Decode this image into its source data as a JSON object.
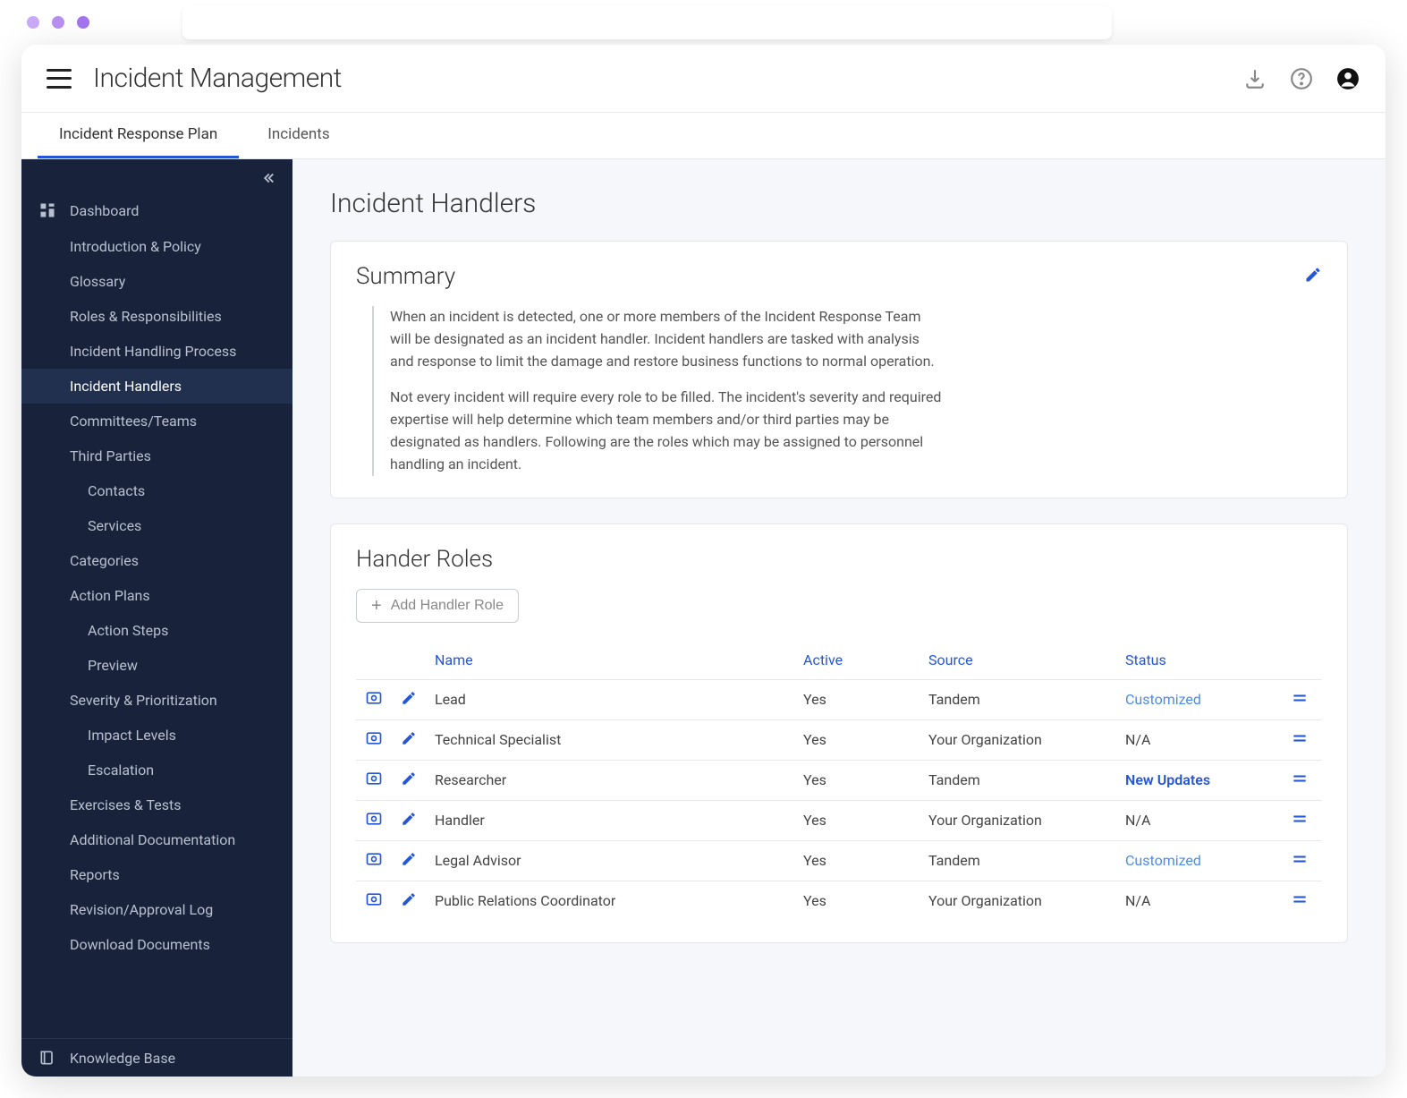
{
  "header": {
    "title": "Incident Management"
  },
  "tabs": [
    {
      "label": "Incident Response Plan",
      "active": true
    },
    {
      "label": "Incidents",
      "active": false
    }
  ],
  "sidebar": {
    "items": [
      {
        "label": "Dashboard",
        "icon": "dashboard"
      },
      {
        "label": "Introduction & Policy",
        "indent": 1
      },
      {
        "label": "Glossary",
        "indent": 1
      },
      {
        "label": "Roles & Responsibilities",
        "indent": 1
      },
      {
        "label": "Incident Handling Process",
        "indent": 1
      },
      {
        "label": "Incident Handlers",
        "indent": 1,
        "active": true
      },
      {
        "label": "Committees/Teams",
        "indent": 1
      },
      {
        "label": "Third Parties",
        "indent": 1
      },
      {
        "label": "Contacts",
        "indent": 2
      },
      {
        "label": "Services",
        "indent": 2
      },
      {
        "label": "Categories",
        "indent": 1
      },
      {
        "label": "Action Plans",
        "indent": 1
      },
      {
        "label": "Action Steps",
        "indent": 2
      },
      {
        "label": "Preview",
        "indent": 2
      },
      {
        "label": "Severity & Prioritization",
        "indent": 1
      },
      {
        "label": "Impact Levels",
        "indent": 2
      },
      {
        "label": "Escalation",
        "indent": 2
      },
      {
        "label": "Exercises & Tests",
        "indent": 1
      },
      {
        "label": "Additional Documentation",
        "indent": 1
      },
      {
        "label": "Reports",
        "indent": 1
      },
      {
        "label": "Revision/Approval Log",
        "indent": 1
      },
      {
        "label": "Download Documents",
        "indent": 1
      }
    ],
    "bottom": {
      "label": "Knowledge Base",
      "icon": "book"
    }
  },
  "page": {
    "title": "Incident Handlers",
    "summary": {
      "title": "Summary",
      "p1": "When an incident is detected, one or more members of the Incident Response Team will be designated as an incident handler. Incident handlers are tasked with analysis and response to limit the damage and restore business functions to normal operation.",
      "p2": "Not every incident will require every role to be filled. The incident's severity and required expertise will help determine which team members and/or third parties may be designated as handlers. Following are the roles which may be assigned to personnel handling an incident."
    },
    "roles": {
      "title": "Hander Roles",
      "add_label": "Add Handler Role",
      "columns": {
        "name": "Name",
        "active": "Active",
        "source": "Source",
        "status": "Status"
      },
      "rows": [
        {
          "name": "Lead",
          "active": "Yes",
          "source": "Tandem",
          "status": "Customized",
          "status_style": "link"
        },
        {
          "name": "Technical Specialist",
          "active": "Yes",
          "source": "Your Organization",
          "status": "N/A",
          "status_style": "plain"
        },
        {
          "name": "Researcher",
          "active": "Yes",
          "source": "Tandem",
          "status": "New Updates",
          "status_style": "bold"
        },
        {
          "name": "Handler",
          "active": "Yes",
          "source": "Your Organization",
          "status": "N/A",
          "status_style": "plain"
        },
        {
          "name": "Legal Advisor",
          "active": "Yes",
          "source": "Tandem",
          "status": "Customized",
          "status_style": "link"
        },
        {
          "name": "Public Relations Coordinator",
          "active": "Yes",
          "source": "Your Organization",
          "status": "N/A",
          "status_style": "plain"
        }
      ]
    }
  }
}
